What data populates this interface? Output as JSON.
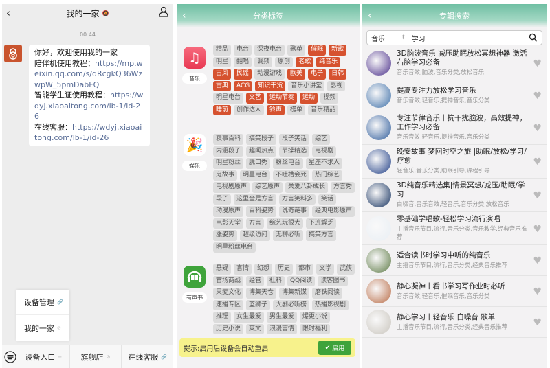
{
  "left": {
    "title": "我的一家",
    "mute_icon": "bell-off-icon",
    "time": "00:44",
    "message": [
      {
        "text": "你好，欢迎使用我的一家",
        "link": ""
      },
      {
        "text": "陪伴机使用教程：",
        "link": "https://mp.weixin.qq.com/s/qRcgkQ36WzwpW_5pmDabFQ"
      },
      {
        "text": "智能学生证使用教程：",
        "link": "https://wdyj.xiaoaitong.com/lb-1/id-26"
      },
      {
        "text": "在线客服：",
        "link": "https://wdyj.xiaoaitong.com/lb-1/id-26"
      }
    ],
    "popup_menu": [
      "设备管理",
      "我的一家"
    ],
    "bottom_menu": [
      "设备入口",
      "旗舰店",
      "在线客服"
    ]
  },
  "mid": {
    "title": "分类标签",
    "categories": [
      {
        "label": "音乐",
        "tags": [
          [
            "精品",
            0
          ],
          [
            "电台",
            0
          ],
          [
            "深夜电台",
            0
          ],
          [
            "歌单",
            0
          ],
          [
            "催眠",
            1
          ],
          [
            "新歌",
            1
          ],
          [
            "明星",
            0
          ],
          [
            "翻唱",
            0
          ],
          [
            "调频",
            0
          ],
          [
            "原创",
            0
          ],
          [
            "老歌",
            1
          ],
          [
            "纯音乐",
            1
          ],
          [
            "古风",
            1
          ],
          [
            "民谣",
            1
          ],
          [
            "动漫游戏",
            0
          ],
          [
            "欧美",
            1
          ],
          [
            "电子",
            1
          ],
          [
            "日韩",
            1
          ],
          [
            "古典",
            1
          ],
          [
            "ACG",
            1
          ],
          [
            "知识干货",
            1
          ],
          [
            "音乐小讲堂",
            0
          ],
          [
            "影视",
            0
          ],
          [
            "明星电台",
            0
          ],
          [
            "文艺",
            1
          ],
          [
            "运动节奏",
            1
          ],
          [
            "运动",
            1
          ],
          [
            "视频",
            0
          ],
          [
            "睡前",
            1
          ],
          [
            "创作达人",
            0
          ],
          [
            "铃声",
            1
          ],
          [
            "榜单",
            0
          ],
          [
            "音乐精品",
            0
          ]
        ]
      },
      {
        "label": "娱乐",
        "tags": [
          [
            "糗事百科",
            0
          ],
          [
            "搞笑段子",
            0
          ],
          [
            "段子笑话",
            0
          ],
          [
            "综艺",
            0
          ],
          [
            "内涵段子",
            0
          ],
          [
            "趣闻热点",
            0
          ],
          [
            "节操精选",
            0
          ],
          [
            "电视剧",
            0
          ],
          [
            "明星粉丝",
            0
          ],
          [
            "脱口秀",
            0
          ],
          [
            "粉丝电台",
            0
          ],
          [
            "星座不求人",
            0
          ],
          [
            "鬼故事",
            0
          ],
          [
            "明星电台",
            0
          ],
          [
            "不吐槽会死",
            0
          ],
          [
            "热门综艺",
            0
          ],
          [
            "电视剧原声",
            0
          ],
          [
            "综艺原声",
            0
          ],
          [
            "关爱八卦成长",
            0
          ],
          [
            "方言秀",
            0
          ],
          [
            "段子",
            0
          ],
          [
            "这里全是方言",
            0
          ],
          [
            "方言笑料多",
            0
          ],
          [
            "笑话",
            0
          ],
          [
            "动漫原声",
            0
          ],
          [
            "百科姿势",
            0
          ],
          [
            "说奇葩事",
            0
          ],
          [
            "经典电影原声",
            0
          ],
          [
            "电影天堂",
            0
          ],
          [
            "方言",
            0
          ],
          [
            "综艺玩很大",
            0
          ],
          [
            "下班解乏",
            0
          ],
          [
            "涨姿势",
            0
          ],
          [
            "超级访问",
            0
          ],
          [
            "无聊必听",
            0
          ],
          [
            "搞笑方言",
            0
          ],
          [
            "明星粉丝电台",
            0
          ]
        ]
      },
      {
        "label": "有声书",
        "tags": [
          [
            "悬疑",
            0
          ],
          [
            "言情",
            0
          ],
          [
            "幻想",
            0
          ],
          [
            "历史",
            0
          ],
          [
            "都市",
            0
          ],
          [
            "文学",
            0
          ],
          [
            "武侠",
            0
          ],
          [
            "官场商战",
            0
          ],
          [
            "经管",
            0
          ],
          [
            "社科",
            0
          ],
          [
            "QQ阅读",
            0
          ],
          [
            "读客图书",
            0
          ],
          [
            "果麦文化",
            0
          ],
          [
            "博集天卷",
            0
          ],
          [
            "博集新媒",
            0
          ],
          [
            "磨铁阅读",
            0
          ],
          [
            "速播专区",
            0
          ],
          [
            "蓝狮子",
            0
          ],
          [
            "大剧必听榜",
            0
          ],
          [
            "热播影视剧",
            0
          ],
          [
            "推理",
            0
          ],
          [
            "女生最爱",
            0
          ],
          [
            "男生最爱",
            0
          ],
          [
            "爆更小说",
            0
          ],
          [
            "历史小说",
            0
          ],
          [
            "爽文",
            0
          ],
          [
            "浪漫言情",
            0
          ],
          [
            "限时福利",
            0
          ]
        ]
      }
    ],
    "tip": "提示:启用后设备会自动重启",
    "enable": "启用"
  },
  "right": {
    "title": "专辑搜索",
    "category": "音乐",
    "keyword": "学习",
    "albums": [
      {
        "title": "3D脑波音乐|减压助眠放松冥想神器 激活右脑学习必备",
        "tags": "音乐音效,脑波,音乐分类,放松音乐",
        "cover": "#4a2f8a"
      },
      {
        "title": "提高专注力放松学习音乐",
        "tags": "音乐音效,轻音乐,提神音乐,音乐分类",
        "cover": "#3d6fa8"
      },
      {
        "title": "专注节律音乐丨抗干扰脑波，高效提神，工作学习必备",
        "tags": "音乐音效,轻音乐,提神音乐,音乐分类",
        "cover": "#2c5a9a"
      },
      {
        "title": "晚安故事 梦回时空之旅 |助眠/放松/学习/疗愈",
        "tags": "轻音乐,音乐分类,助眠引导,课程引导",
        "cover": "#1f3e86"
      },
      {
        "title": "3D纯音乐精选集|情景冥想/减压/助眠/学习",
        "tags": "白噪音,音乐音效,轻音乐,音乐分类,放松音乐",
        "cover": "#13305e"
      },
      {
        "title": "零基础学唱歌-轻松学习流行演唱",
        "tags": "主播音乐节目,流行,音乐分类,音乐教学,经典音乐推荐",
        "cover": "#e8eef4"
      },
      {
        "title": "适合读书时学习中听的纯音乐",
        "tags": "主播音乐节目,流行,音乐分类,经典音乐推荐",
        "cover": "#5d7a45"
      },
      {
        "title": "静心凝神丨看书学习写作业时必听",
        "tags": "音乐音效,轻音乐,催眠音乐,音乐分类",
        "cover": "#b86b45"
      },
      {
        "title": "静心学习丨轻音乐 白噪音 歌单",
        "tags": "主播音乐节目,流行,音乐分类,经典音乐推荐",
        "cover": "#c8c4bc"
      }
    ]
  }
}
